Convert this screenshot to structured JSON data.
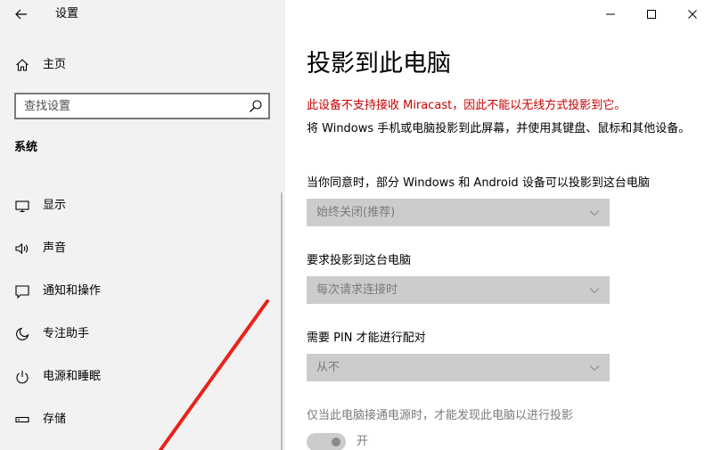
{
  "window": {
    "title": "设置",
    "controls": [
      "minimize",
      "maximize",
      "close"
    ]
  },
  "sidebar": {
    "home_label": "主页",
    "search_placeholder": "查找设置",
    "section_label": "系统",
    "items": [
      {
        "label": "显示",
        "icon": "display-icon"
      },
      {
        "label": "声音",
        "icon": "speaker-icon"
      },
      {
        "label": "通知和操作",
        "icon": "notification-icon"
      },
      {
        "label": "专注助手",
        "icon": "moon-icon"
      },
      {
        "label": "电源和睡眠",
        "icon": "power-icon"
      },
      {
        "label": "存储",
        "icon": "storage-icon"
      }
    ]
  },
  "main": {
    "title": "投影到此电脑",
    "warning": "此设备不支持接收 Miracast，因此不能以无线方式投影到它。",
    "description": "将 Windows 手机或电脑投影到此屏幕，并使用其键盘、鼠标和其他设备。",
    "settings": [
      {
        "label": "当你同意时，部分 Windows 和 Android 设备可以投影到这台电脑",
        "value": "始终关闭(推荐)"
      },
      {
        "label": "要求投影到这台电脑",
        "value": "每次请求连接时"
      },
      {
        "label": "需要 PIN 才能进行配对",
        "value": "从不"
      }
    ],
    "power_label": "仅当此电脑接通电源时，才能发现此电脑以进行投影",
    "toggle_label": "开"
  },
  "colors": {
    "sidebar_bg": "#f2f2f2",
    "warning": "#c50000",
    "disabled_text": "#7a7a7a",
    "dropdown_bg": "#cccccc",
    "annotation_line": "#e8231a"
  }
}
